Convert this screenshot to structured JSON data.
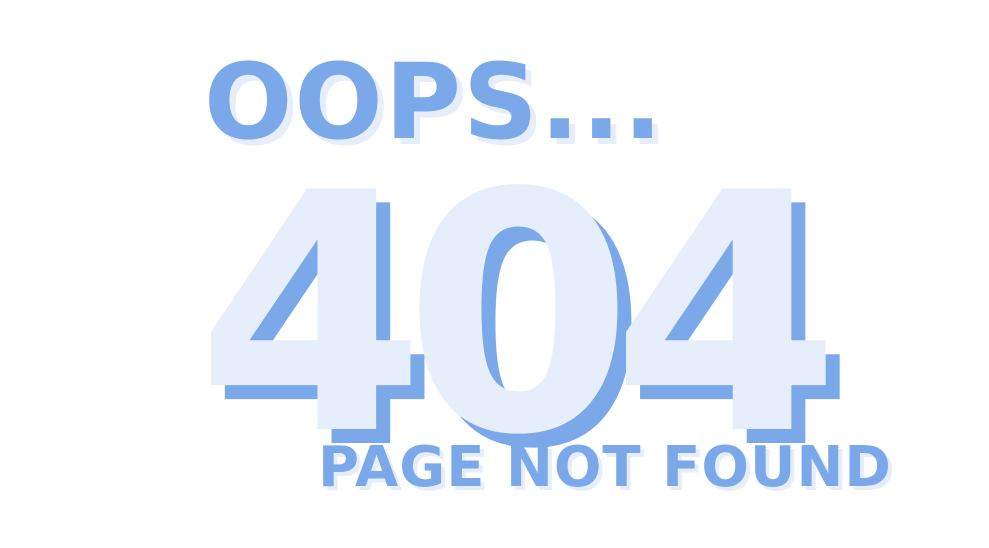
{
  "message": {
    "oops": "OOPS...",
    "code": "404",
    "subtitle": "PAGE NOT FOUND"
  },
  "colors": {
    "primary_blue": "#7aa8e9",
    "light_blue": "#e6eefb",
    "background": "#ffffff"
  }
}
